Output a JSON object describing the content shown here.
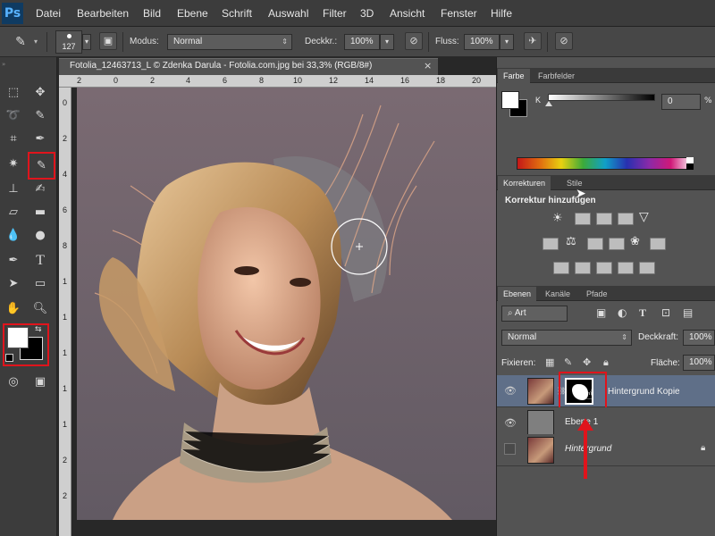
{
  "app": {
    "logo_text": "Ps"
  },
  "menu": [
    "Datei",
    "Bearbeiten",
    "Bild",
    "Ebene",
    "Schrift",
    "Auswahl",
    "Filter",
    "3D",
    "Ansicht",
    "Fenster",
    "Hilfe"
  ],
  "options": {
    "brush_size": "127",
    "mode_label": "Modus:",
    "mode_value": "Normal",
    "opacity_label": "Deckkr.:",
    "opacity_value": "100%",
    "flow_label": "Fluss:",
    "flow_value": "100%"
  },
  "document": {
    "title": "Fotolia_12463713_L © Zdenka Darula - Fotolia.com.jpg bei 33,3% (RGB/8#)",
    "close_glyph": "×",
    "ruler_top": [
      "2",
      "0",
      "2",
      "4",
      "6",
      "8",
      "10",
      "12",
      "14",
      "16",
      "18",
      "20"
    ],
    "ruler_left": [
      "0",
      "2",
      "4",
      "6",
      "8",
      "1",
      "1",
      "1",
      "1",
      "1",
      "2",
      "2"
    ]
  },
  "color_panel": {
    "tabs": [
      "Farbe",
      "Farbfelder"
    ],
    "channel_label": "K",
    "channel_value": "0",
    "unit": "%"
  },
  "adjustments_panel": {
    "tabs": [
      "Korrekturen",
      "Stile"
    ],
    "heading": "Korrektur hinzufügen"
  },
  "layers_panel": {
    "tabs": [
      "Ebenen",
      "Kanäle",
      "Pfade"
    ],
    "filter_kind": "Art",
    "blend_mode": "Normal",
    "opacity_label": "Deckkraft:",
    "opacity_value": "100%",
    "lock_label": "Fixieren:",
    "fill_label": "Fläche:",
    "fill_value": "100%",
    "layers": [
      {
        "name": "Hintergrund Kopie",
        "visible": true,
        "selected": true
      },
      {
        "name": "Ebene 1",
        "visible": true,
        "selected": false
      },
      {
        "name": "Hintergrund",
        "visible": false,
        "selected": false
      }
    ]
  },
  "colors": {
    "highlight_red": "#e0141c",
    "selected_layer": "#5f6f88",
    "foreground": "#ffffff",
    "background": "#000000"
  }
}
